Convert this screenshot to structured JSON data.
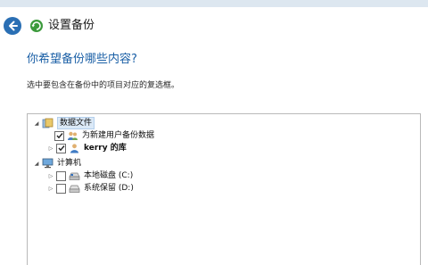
{
  "header": {
    "title": "设置备份",
    "back_icon": "back-arrow-icon",
    "app_icon": "backup-icon",
    "accent": "#2a6fb4"
  },
  "main": {
    "question": "你希望备份哪些内容?",
    "instruction": "选中要包含在备份中的项目对应的复选框。"
  },
  "tree": {
    "libraries": {
      "label": "数据文件",
      "expanded": true,
      "children": [
        {
          "label": "为新建用户备份数据",
          "checked": true
        },
        {
          "label": "kerry 的库",
          "checked": true
        }
      ]
    },
    "computer": {
      "label": "计算机",
      "expanded": true,
      "children": [
        {
          "label": "本地磁盘 (C:)",
          "checked": false
        },
        {
          "label": "系统保留 (D:)",
          "checked": false
        }
      ]
    }
  }
}
